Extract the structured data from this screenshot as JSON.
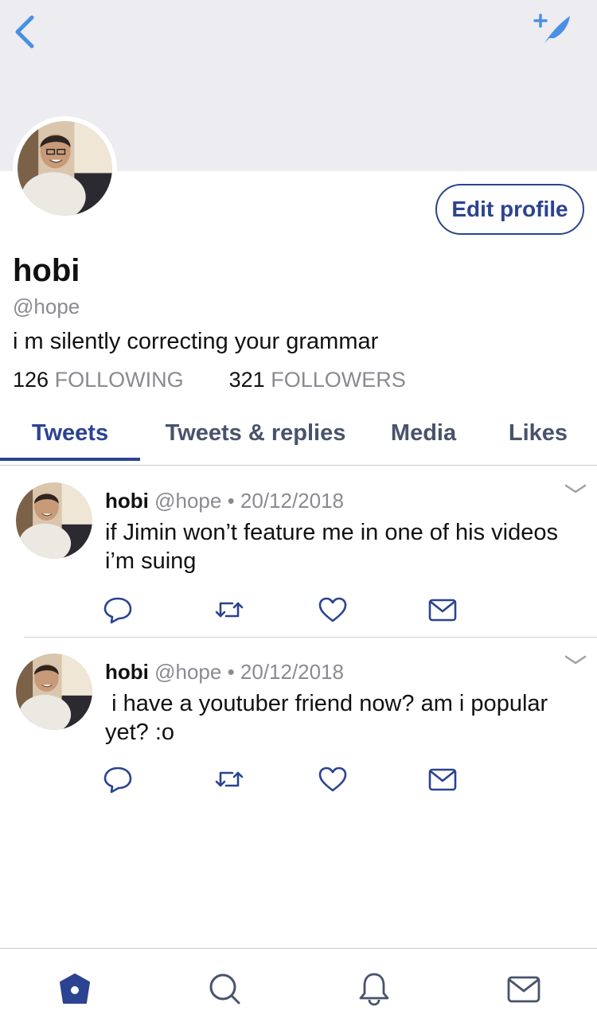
{
  "header": {
    "back_icon": "chevron-left-icon",
    "compose_icon": "compose-tweet-icon",
    "accent_color": "#4a90e2"
  },
  "profile": {
    "display_name": "hobi",
    "handle": "@hope",
    "bio": "i m silently correcting your grammar",
    "edit_label": "Edit profile",
    "following_count": "126",
    "following_label": "FOLLOWING",
    "followers_count": "321",
    "followers_label": "FOLLOWERS"
  },
  "tabs": [
    {
      "label": "Tweets",
      "active": true
    },
    {
      "label": "Tweets & replies",
      "active": false
    },
    {
      "label": "Media",
      "active": false
    },
    {
      "label": "Likes",
      "active": false
    }
  ],
  "tweets": [
    {
      "name": "hobi",
      "handle_date": "@hope • 20/12/2018",
      "text": "if Jimin won’t feature me in one of his videos i’m suing"
    },
    {
      "name": "hobi",
      "handle_date": "@hope • 20/12/2018",
      "text": " i have a youtuber friend now? am i popular yet? :o"
    }
  ],
  "tweet_actions": [
    "reply-icon",
    "retweet-icon",
    "like-icon",
    "direct-message-icon"
  ],
  "bottom_nav": [
    "home-icon",
    "search-icon",
    "notifications-icon",
    "messages-icon"
  ],
  "colors": {
    "brand_blue": "#2b4390",
    "banner_bg": "#ececf1",
    "muted_text": "#8a8a92"
  }
}
